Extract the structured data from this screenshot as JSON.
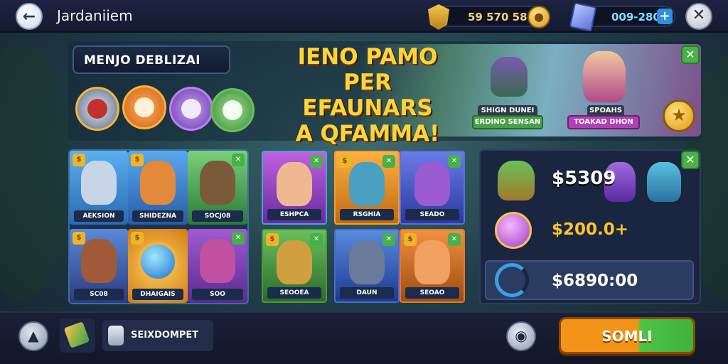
{
  "header": {
    "title": "Jardaniiem",
    "coins": "59 570 58",
    "gems": "009-280",
    "back_icon": "back-arrow-icon",
    "close_icon": "close-icon",
    "coin_icon": "coin-icon",
    "gem_icon": "gem-icon",
    "add_icon": "plus-icon"
  },
  "top_panel": {
    "title": "MENJO DEBLIZAI",
    "pets": [
      "bird-pet",
      "fox-pet",
      "cat-pet",
      "dog-pet"
    ],
    "promo_lines": [
      "IENO PAMO",
      "PER EFAUNARS",
      "A QFAMMA!"
    ],
    "banner_chips": [
      "SHIGN DUNEI",
      "ERDINO SENSAN",
      "SPOAHS",
      "TOAKAD DHON"
    ]
  },
  "grid": {
    "group_a": {
      "cards": [
        {
          "label": "AEKSION",
          "color": "#3a7fd0"
        },
        {
          "label": "SHIDEZNA",
          "color": "#2f6fc0"
        },
        {
          "label": "SOCJ08",
          "color": "#3a9a50"
        },
        {
          "label": "SC08",
          "color": "#3a6ab8"
        },
        {
          "label": "DHAIGAIS",
          "color": "#d98a1a"
        },
        {
          "label": "SOO",
          "color": "#7a3ab8"
        }
      ]
    },
    "group_b": {
      "cards": [
        {
          "label": "ESHPCA",
          "color": "#9a3ab8"
        },
        {
          "label": "RSGHIA",
          "color": "#d98a1a"
        },
        {
          "label": "SEADO",
          "color": "#3a4ac0"
        },
        {
          "label": "SEOOEA",
          "color": "#4a9a3a"
        },
        {
          "label": "DAUN",
          "color": "#3a5ab0"
        },
        {
          "label": "SEOAO",
          "color": "#d06a1a"
        }
      ]
    }
  },
  "right_panel": {
    "top_price": "$5309",
    "mid_price": "$200.0+",
    "bottom_price": "$6890:00"
  },
  "footer": {
    "inventory_label": "SEIXDOMPET",
    "cta_label": "SOMLI",
    "home_icon": "home-icon",
    "settings_icon": "settings-icon"
  }
}
